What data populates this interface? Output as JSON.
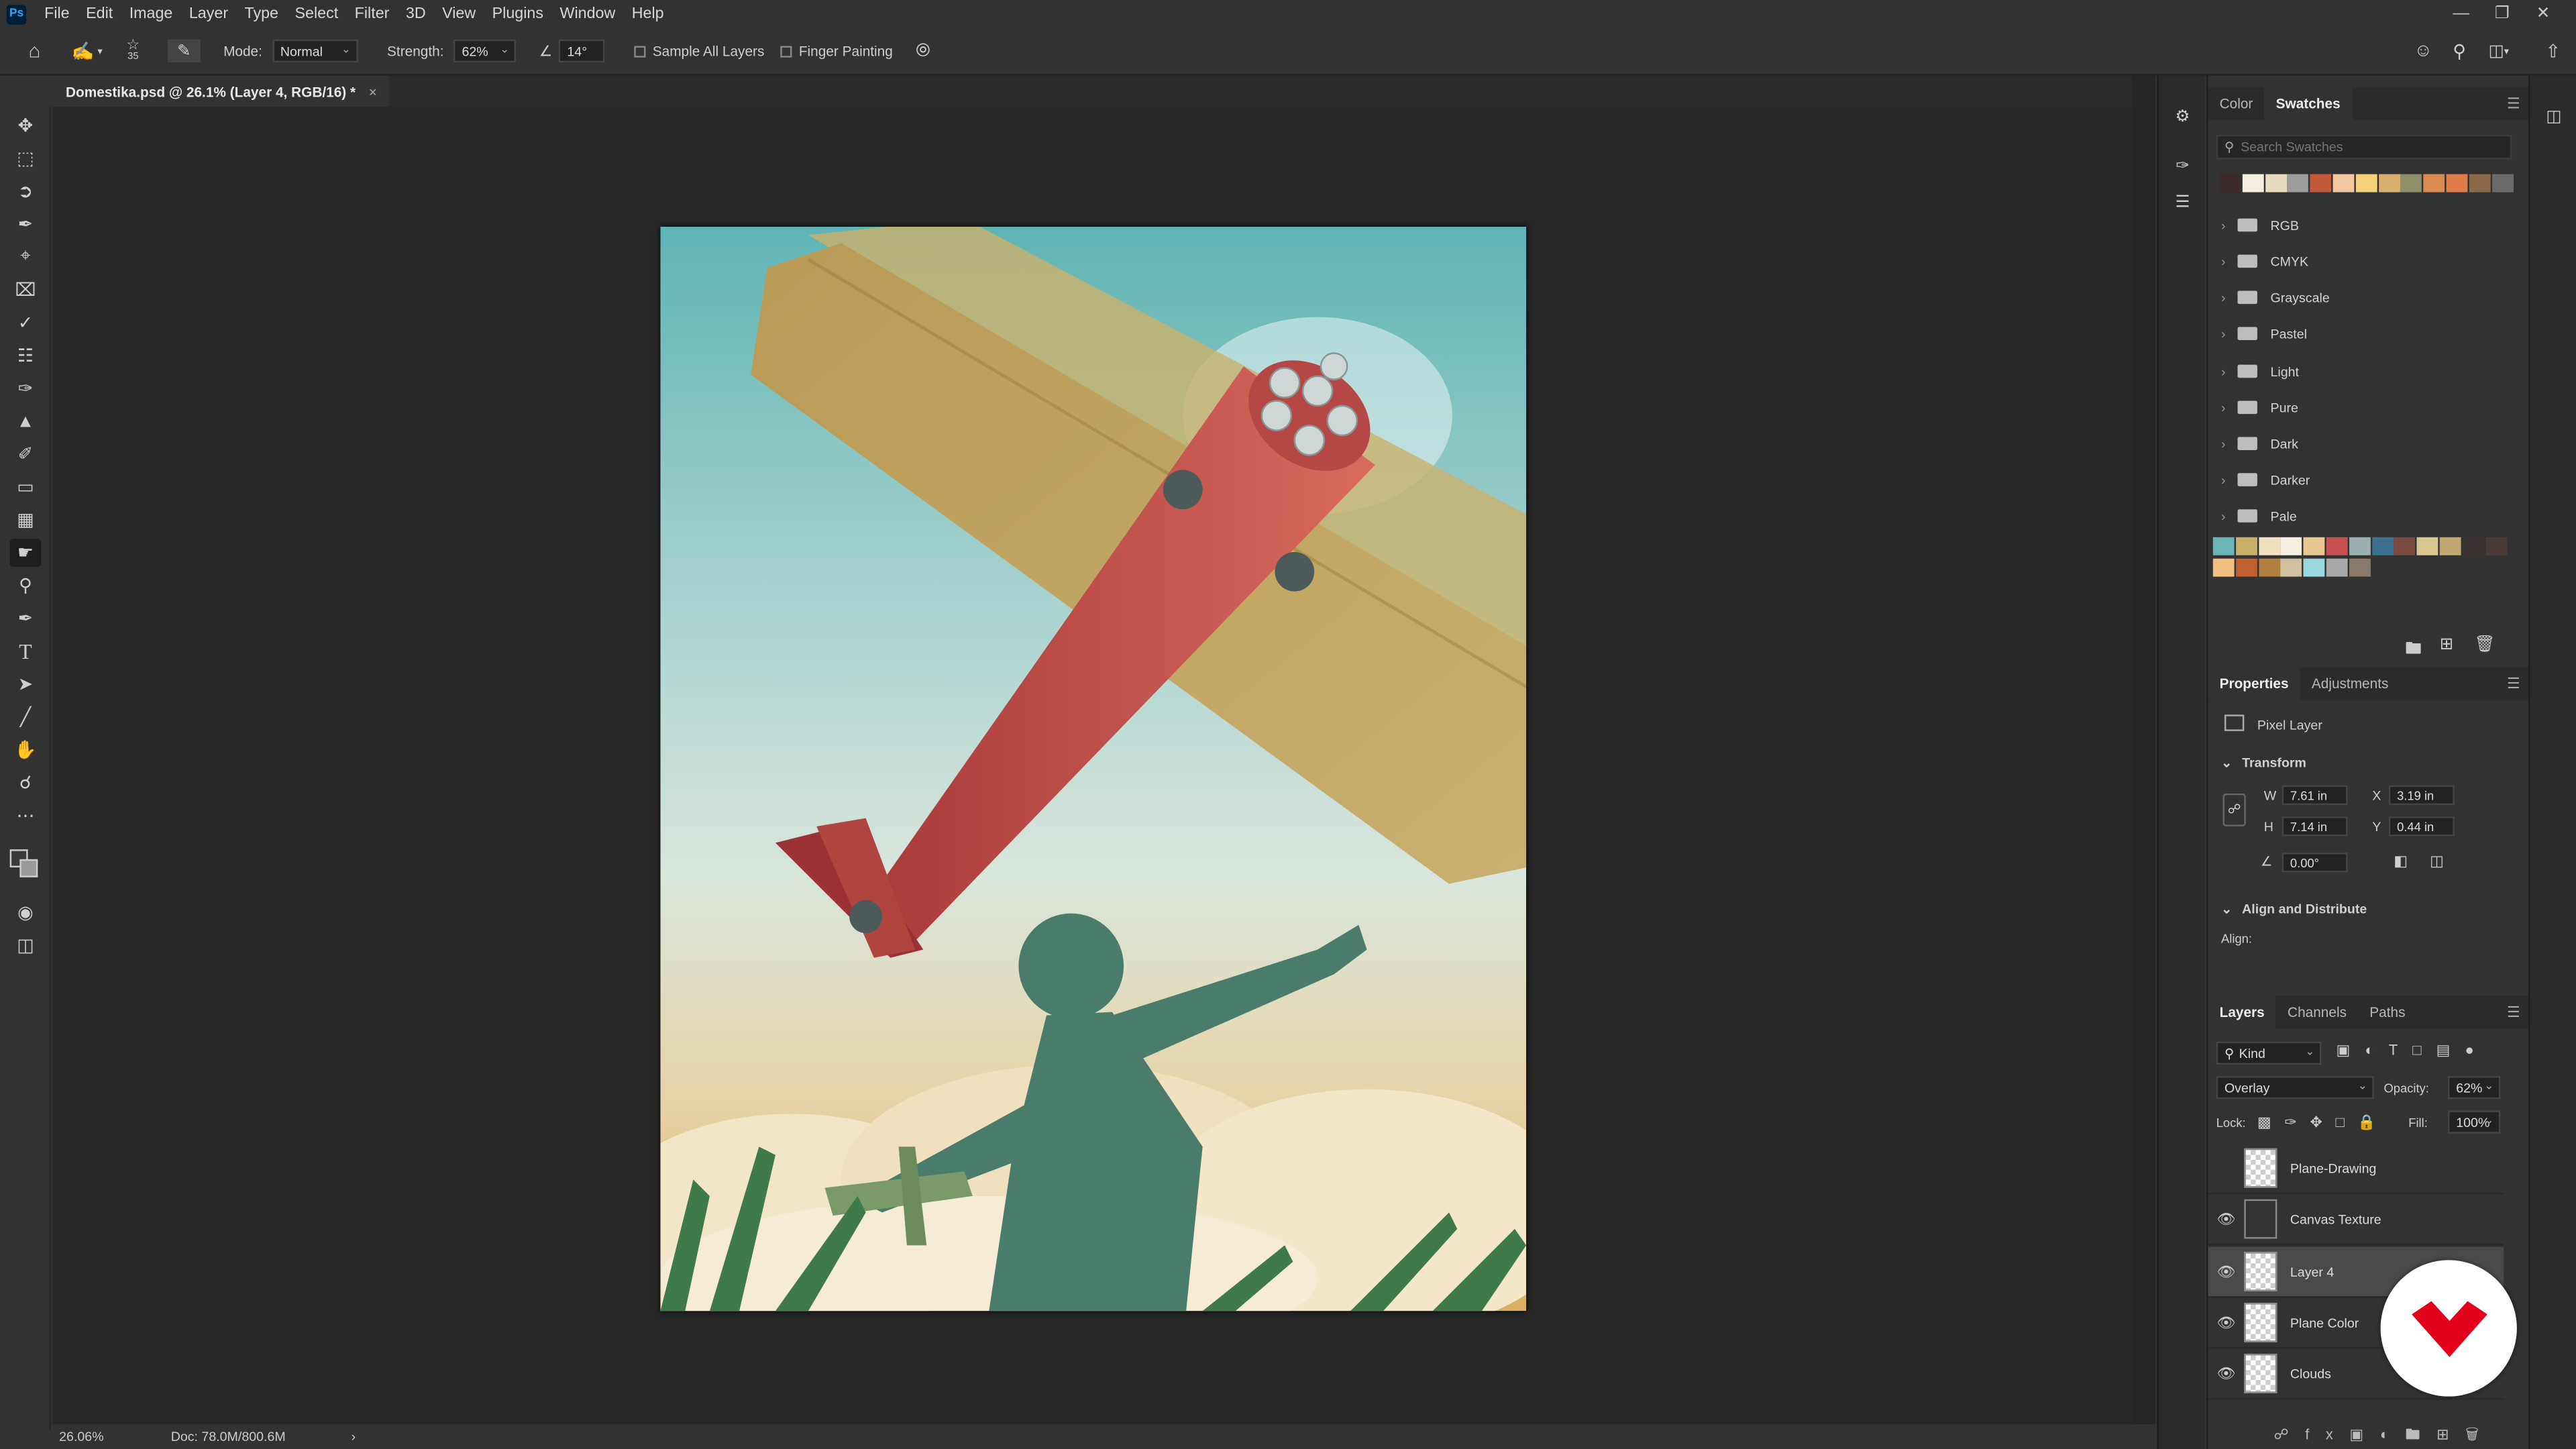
{
  "menubar": {
    "app_badge": "Ps",
    "items": [
      "File",
      "Edit",
      "Image",
      "Layer",
      "Type",
      "Select",
      "Filter",
      "3D",
      "View",
      "Plugins",
      "Window",
      "Help"
    ]
  },
  "options": {
    "brush_size": "35",
    "mode_label": "Mode:",
    "mode_value": "Normal",
    "strength_label": "Strength:",
    "strength_value": "62%",
    "angle_value": "14°",
    "sample_all_layers": "Sample All Layers",
    "finger_painting": "Finger Painting"
  },
  "document_tab": {
    "title": "Domestika.psd @ 26.1% (Layer 4, RGB/16) *",
    "close": "×"
  },
  "status": {
    "zoom": "26.06%",
    "doc": "Doc: 78.0M/800.6M",
    "arrow": "›"
  },
  "swatches_panel": {
    "tabs": [
      "Color",
      "Swatches"
    ],
    "active_tab": "Swatches",
    "search_placeholder": "Search Swatches",
    "recent_colors": [
      "#3a2a2a",
      "#f5efe0",
      "#e8dcc0",
      "#9c9c9c",
      "#c35a3a",
      "#f1c8a0",
      "#f5d27a",
      "#d9b070",
      "#8f8f6a",
      "#d98a50",
      "#e07b4a",
      "#8a6a4a",
      "#6a6a6a"
    ],
    "folders": [
      "RGB",
      "CMYK",
      "Grayscale",
      "Pastel",
      "Light",
      "Pure",
      "Dark",
      "Darker",
      "Pale"
    ],
    "custom_row1": [
      "#6ab5b5",
      "#c8b06a",
      "#f0e0c0",
      "#f5efe0",
      "#e8c890",
      "#c85050",
      "#9ab0b0",
      "#3a7090",
      "#7a4a40",
      "#d8c890",
      "#c0a870",
      "#3a3030",
      "#4a3a38"
    ],
    "custom_row2": [
      "#f0c080",
      "#c06030",
      "#b08040",
      "#d0c0a0",
      "#9ad8e0",
      "#a8a8a8",
      "#8a7a6a"
    ]
  },
  "properties_panel": {
    "tabs": [
      "Properties",
      "Adjustments"
    ],
    "active_tab": "Properties",
    "layer_type": "Pixel Layer",
    "transform_label": "Transform",
    "w_label": "W",
    "w_value": "7.61 in",
    "h_label": "H",
    "h_value": "7.14 in",
    "x_label": "X",
    "x_value": "3.19 in",
    "y_label": "Y",
    "y_value": "0.44 in",
    "angle_value": "0.00°",
    "align_label": "Align and Distribute",
    "align_sub": "Align:"
  },
  "layers_panel": {
    "tabs": [
      "Layers",
      "Channels",
      "Paths"
    ],
    "active_tab": "Layers",
    "filter_kind": "Kind",
    "blend_mode": "Overlay",
    "opacity_label": "Opacity:",
    "opacity_value": "62%",
    "lock_label": "Lock:",
    "fill_label": "Fill:",
    "fill_value": "100%",
    "layers": [
      {
        "name": "Plane-Drawing",
        "visible": false
      },
      {
        "name": "Canvas Texture",
        "visible": true
      },
      {
        "name": "Layer 4",
        "visible": true,
        "selected": true
      },
      {
        "name": "Plane Color",
        "visible": true
      },
      {
        "name": "Clouds",
        "visible": true
      }
    ]
  },
  "colors": {
    "accent": "#1473e6",
    "logo_red": "#e3001b"
  }
}
